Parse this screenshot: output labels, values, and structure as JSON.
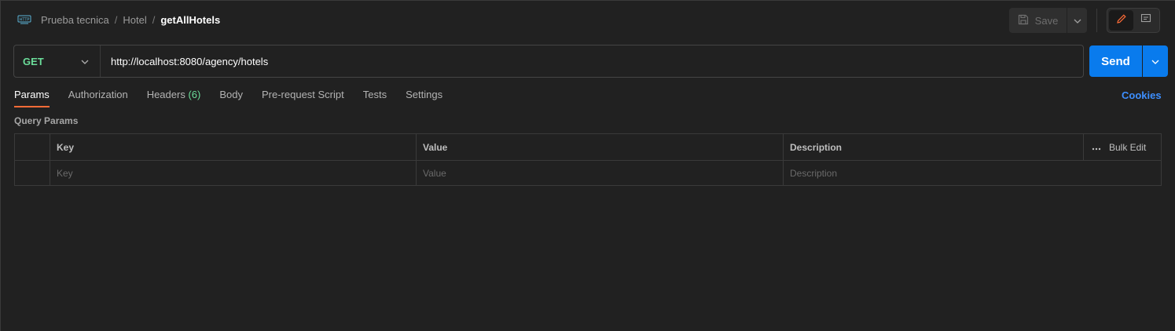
{
  "breadcrumb": {
    "collection": "Prueba tecnica",
    "folder": "Hotel",
    "request": "getAllHotels",
    "separator": "/"
  },
  "toolbar": {
    "save_label": "Save"
  },
  "request": {
    "method": "GET",
    "url": "http://localhost:8080/agency/hotels",
    "send_label": "Send"
  },
  "tabs": {
    "params": "Params",
    "authorization": "Authorization",
    "headers": "Headers",
    "headers_count": "(6)",
    "body": "Body",
    "prerequest": "Pre-request Script",
    "tests": "Tests",
    "settings": "Settings",
    "cookies": "Cookies"
  },
  "query_params": {
    "title": "Query Params",
    "columns": {
      "key": "Key",
      "value": "Value",
      "description": "Description"
    },
    "bulk_edit": "Bulk Edit",
    "placeholders": {
      "key": "Key",
      "value": "Value",
      "description": "Description"
    }
  },
  "colors": {
    "background": "#212121",
    "method_get": "#6bdd9a",
    "send_button": "#097bed",
    "active_tab_underline": "#ff6c37",
    "cookies_link": "#3d8fff"
  },
  "icons": {
    "http": "http-icon",
    "save": "save-icon",
    "edit": "pencil-icon",
    "comments": "comment-icon",
    "more": "more-horizontal-icon"
  }
}
